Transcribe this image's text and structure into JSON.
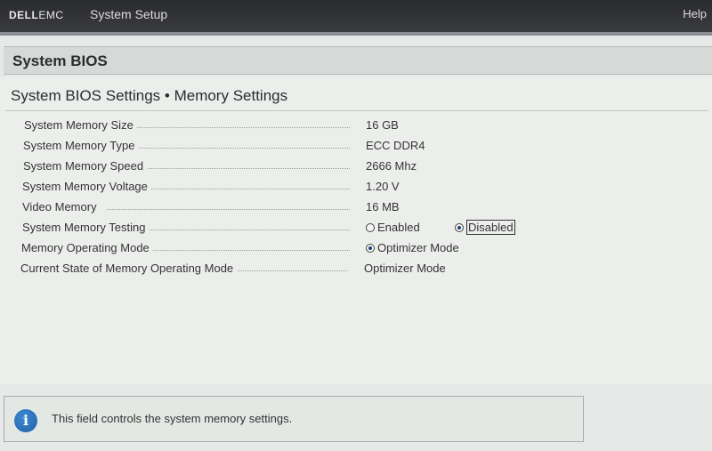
{
  "topbar": {
    "brand_dell": "DELL",
    "brand_emc": "EMC",
    "app_title": "System Setup",
    "help": "Help"
  },
  "section": {
    "title": "System BIOS"
  },
  "page": {
    "title": "System BIOS Settings • Memory Settings"
  },
  "settings": [
    {
      "label": "System Memory Size",
      "value": "16 GB"
    },
    {
      "label": "System Memory Type",
      "value": "ECC DDR4"
    },
    {
      "label": "System Memory Speed",
      "value": "2666 Mhz"
    },
    {
      "label": "System Memory Voltage",
      "value": "1.20 V"
    },
    {
      "label": "Video Memory",
      "value": "16 MB"
    },
    {
      "label": "System Memory Testing",
      "options": [
        "Enabled",
        "Disabled"
      ],
      "selected": "Disabled"
    },
    {
      "label": "Memory Operating Mode",
      "options": [
        "Optimizer Mode"
      ],
      "selected": "Optimizer Mode"
    },
    {
      "label": "Current State of Memory Operating Mode",
      "value": "Optimizer Mode"
    }
  ],
  "help_panel": {
    "text": "This field controls the system memory settings."
  }
}
